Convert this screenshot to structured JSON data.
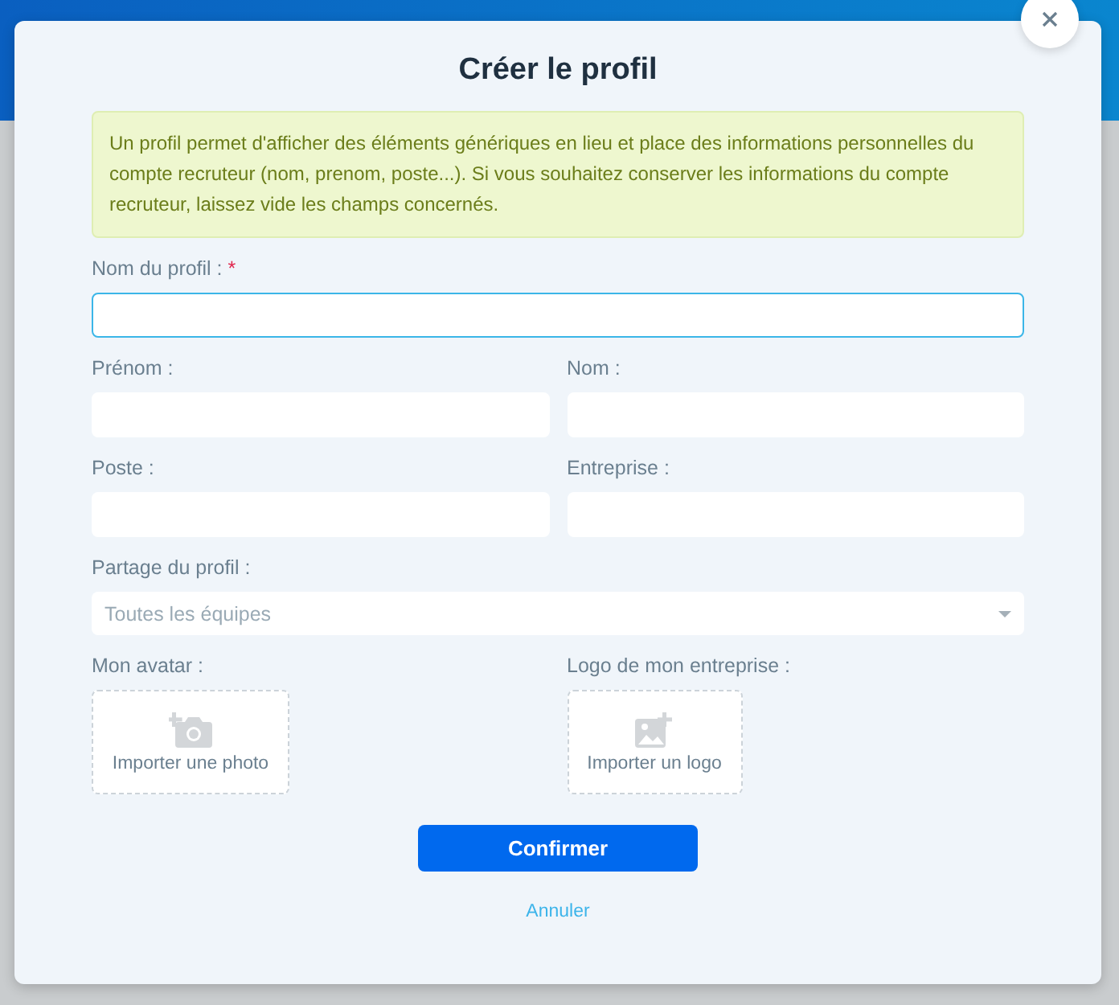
{
  "dialog": {
    "title": "Créer le profil",
    "notice": "Un profil permet d'afficher des éléments génériques en lieu et place des informations personnelles du compte recruteur (nom, prenom, poste...). Si vous souhaitez conserver les informations du compte recruteur, laissez vide les champs concernés.",
    "profile_name": {
      "label": "Nom du profil :",
      "required_mark": "*",
      "focused": true
    },
    "fields": [
      {
        "label": "Prénom :"
      },
      {
        "label": "Nom :"
      },
      {
        "label": "Poste :"
      },
      {
        "label": "Entreprise :"
      }
    ],
    "sharing": {
      "label": "Partage du profil :",
      "placeholder": "Toutes les équipes"
    },
    "uploads": [
      {
        "kind": "photo",
        "label": "Mon avatar :",
        "action": "Importer une photo"
      },
      {
        "kind": "logo",
        "label": "Logo de mon entreprise :",
        "action": "Importer un logo"
      }
    ],
    "confirm": "Confirmer",
    "cancel": "Annuler"
  }
}
